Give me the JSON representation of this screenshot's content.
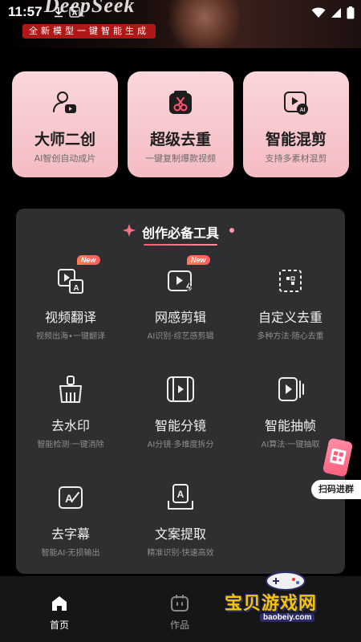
{
  "status_bar": {
    "time": "11:57"
  },
  "banner": {
    "logo": "DeepSeek",
    "tagline": "全新模型一键智能生成"
  },
  "feature_cards": [
    {
      "title": "大师二创",
      "subtitle": "AI智创自动成片",
      "icon": "user-video-icon"
    },
    {
      "title": "超级去重",
      "subtitle": "一键复制爆款视频",
      "icon": "scissors-icon"
    },
    {
      "title": "智能混剪",
      "subtitle": "支持多素材混剪",
      "icon": "ai-video-icon"
    }
  ],
  "tools": {
    "heading": "创作必备工具",
    "badge_new": "New",
    "items": [
      {
        "title": "视频翻译",
        "subtitle": "视频出海•一键翻译",
        "icon": "translate-icon",
        "new": true
      },
      {
        "title": "网感剪辑",
        "subtitle": "AI识别·综艺感剪辑",
        "icon": "flash-video-icon",
        "new": true
      },
      {
        "title": "自定义去重",
        "subtitle": "多种方法·随心去重",
        "icon": "custom-dedupe-icon",
        "new": false
      },
      {
        "title": "去水印",
        "subtitle": "智能检测·一键消除",
        "icon": "broom-icon",
        "new": false
      },
      {
        "title": "智能分镜",
        "subtitle": "AI分镜·多维度拆分",
        "icon": "storyboard-icon",
        "new": false
      },
      {
        "title": "智能抽帧",
        "subtitle": "AI算法·一键抽取",
        "icon": "frame-extract-icon",
        "new": false
      },
      {
        "title": "去字幕",
        "subtitle": "智能AI·无损输出",
        "icon": "remove-subtitle-icon",
        "new": false
      },
      {
        "title": "文案提取",
        "subtitle": "精准识别·快速高效",
        "icon": "text-extract-icon",
        "new": false
      }
    ]
  },
  "qr_float": {
    "label": "扫码进群"
  },
  "bottom_nav": [
    {
      "label": "首页",
      "icon": "home-icon",
      "active": true
    },
    {
      "label": "作品",
      "icon": "works-icon",
      "active": false
    }
  ],
  "watermark": {
    "text": "宝贝游戏网",
    "url": "baobeiy.com"
  }
}
